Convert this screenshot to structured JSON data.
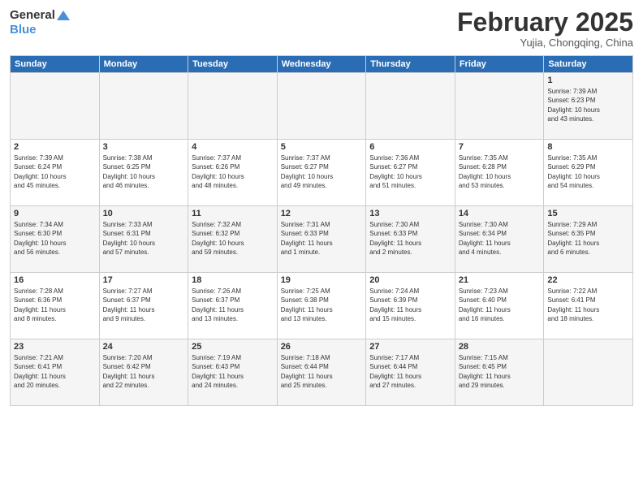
{
  "logo": {
    "line1": "General",
    "line2": "Blue"
  },
  "title": "February 2025",
  "location": "Yujia, Chongqing, China",
  "weekdays": [
    "Sunday",
    "Monday",
    "Tuesday",
    "Wednesday",
    "Thursday",
    "Friday",
    "Saturday"
  ],
  "weeks": [
    [
      {
        "day": "",
        "info": ""
      },
      {
        "day": "",
        "info": ""
      },
      {
        "day": "",
        "info": ""
      },
      {
        "day": "",
        "info": ""
      },
      {
        "day": "",
        "info": ""
      },
      {
        "day": "",
        "info": ""
      },
      {
        "day": "1",
        "info": "Sunrise: 7:39 AM\nSunset: 6:23 PM\nDaylight: 10 hours\nand 43 minutes."
      }
    ],
    [
      {
        "day": "2",
        "info": "Sunrise: 7:39 AM\nSunset: 6:24 PM\nDaylight: 10 hours\nand 45 minutes."
      },
      {
        "day": "3",
        "info": "Sunrise: 7:38 AM\nSunset: 6:25 PM\nDaylight: 10 hours\nand 46 minutes."
      },
      {
        "day": "4",
        "info": "Sunrise: 7:37 AM\nSunset: 6:26 PM\nDaylight: 10 hours\nand 48 minutes."
      },
      {
        "day": "5",
        "info": "Sunrise: 7:37 AM\nSunset: 6:27 PM\nDaylight: 10 hours\nand 49 minutes."
      },
      {
        "day": "6",
        "info": "Sunrise: 7:36 AM\nSunset: 6:27 PM\nDaylight: 10 hours\nand 51 minutes."
      },
      {
        "day": "7",
        "info": "Sunrise: 7:35 AM\nSunset: 6:28 PM\nDaylight: 10 hours\nand 53 minutes."
      },
      {
        "day": "8",
        "info": "Sunrise: 7:35 AM\nSunset: 6:29 PM\nDaylight: 10 hours\nand 54 minutes."
      }
    ],
    [
      {
        "day": "9",
        "info": "Sunrise: 7:34 AM\nSunset: 6:30 PM\nDaylight: 10 hours\nand 56 minutes."
      },
      {
        "day": "10",
        "info": "Sunrise: 7:33 AM\nSunset: 6:31 PM\nDaylight: 10 hours\nand 57 minutes."
      },
      {
        "day": "11",
        "info": "Sunrise: 7:32 AM\nSunset: 6:32 PM\nDaylight: 10 hours\nand 59 minutes."
      },
      {
        "day": "12",
        "info": "Sunrise: 7:31 AM\nSunset: 6:33 PM\nDaylight: 11 hours\nand 1 minute."
      },
      {
        "day": "13",
        "info": "Sunrise: 7:30 AM\nSunset: 6:33 PM\nDaylight: 11 hours\nand 2 minutes."
      },
      {
        "day": "14",
        "info": "Sunrise: 7:30 AM\nSunset: 6:34 PM\nDaylight: 11 hours\nand 4 minutes."
      },
      {
        "day": "15",
        "info": "Sunrise: 7:29 AM\nSunset: 6:35 PM\nDaylight: 11 hours\nand 6 minutes."
      }
    ],
    [
      {
        "day": "16",
        "info": "Sunrise: 7:28 AM\nSunset: 6:36 PM\nDaylight: 11 hours\nand 8 minutes."
      },
      {
        "day": "17",
        "info": "Sunrise: 7:27 AM\nSunset: 6:37 PM\nDaylight: 11 hours\nand 9 minutes."
      },
      {
        "day": "18",
        "info": "Sunrise: 7:26 AM\nSunset: 6:37 PM\nDaylight: 11 hours\nand 13 minutes."
      },
      {
        "day": "19",
        "info": "Sunrise: 7:25 AM\nSunset: 6:38 PM\nDaylight: 11 hours\nand 13 minutes."
      },
      {
        "day": "20",
        "info": "Sunrise: 7:24 AM\nSunset: 6:39 PM\nDaylight: 11 hours\nand 15 minutes."
      },
      {
        "day": "21",
        "info": "Sunrise: 7:23 AM\nSunset: 6:40 PM\nDaylight: 11 hours\nand 16 minutes."
      },
      {
        "day": "22",
        "info": "Sunrise: 7:22 AM\nSunset: 6:41 PM\nDaylight: 11 hours\nand 18 minutes."
      }
    ],
    [
      {
        "day": "23",
        "info": "Sunrise: 7:21 AM\nSunset: 6:41 PM\nDaylight: 11 hours\nand 20 minutes."
      },
      {
        "day": "24",
        "info": "Sunrise: 7:20 AM\nSunset: 6:42 PM\nDaylight: 11 hours\nand 22 minutes."
      },
      {
        "day": "25",
        "info": "Sunrise: 7:19 AM\nSunset: 6:43 PM\nDaylight: 11 hours\nand 24 minutes."
      },
      {
        "day": "26",
        "info": "Sunrise: 7:18 AM\nSunset: 6:44 PM\nDaylight: 11 hours\nand 25 minutes."
      },
      {
        "day": "27",
        "info": "Sunrise: 7:17 AM\nSunset: 6:44 PM\nDaylight: 11 hours\nand 27 minutes."
      },
      {
        "day": "28",
        "info": "Sunrise: 7:15 AM\nSunset: 6:45 PM\nDaylight: 11 hours\nand 29 minutes."
      },
      {
        "day": "",
        "info": ""
      }
    ]
  ]
}
